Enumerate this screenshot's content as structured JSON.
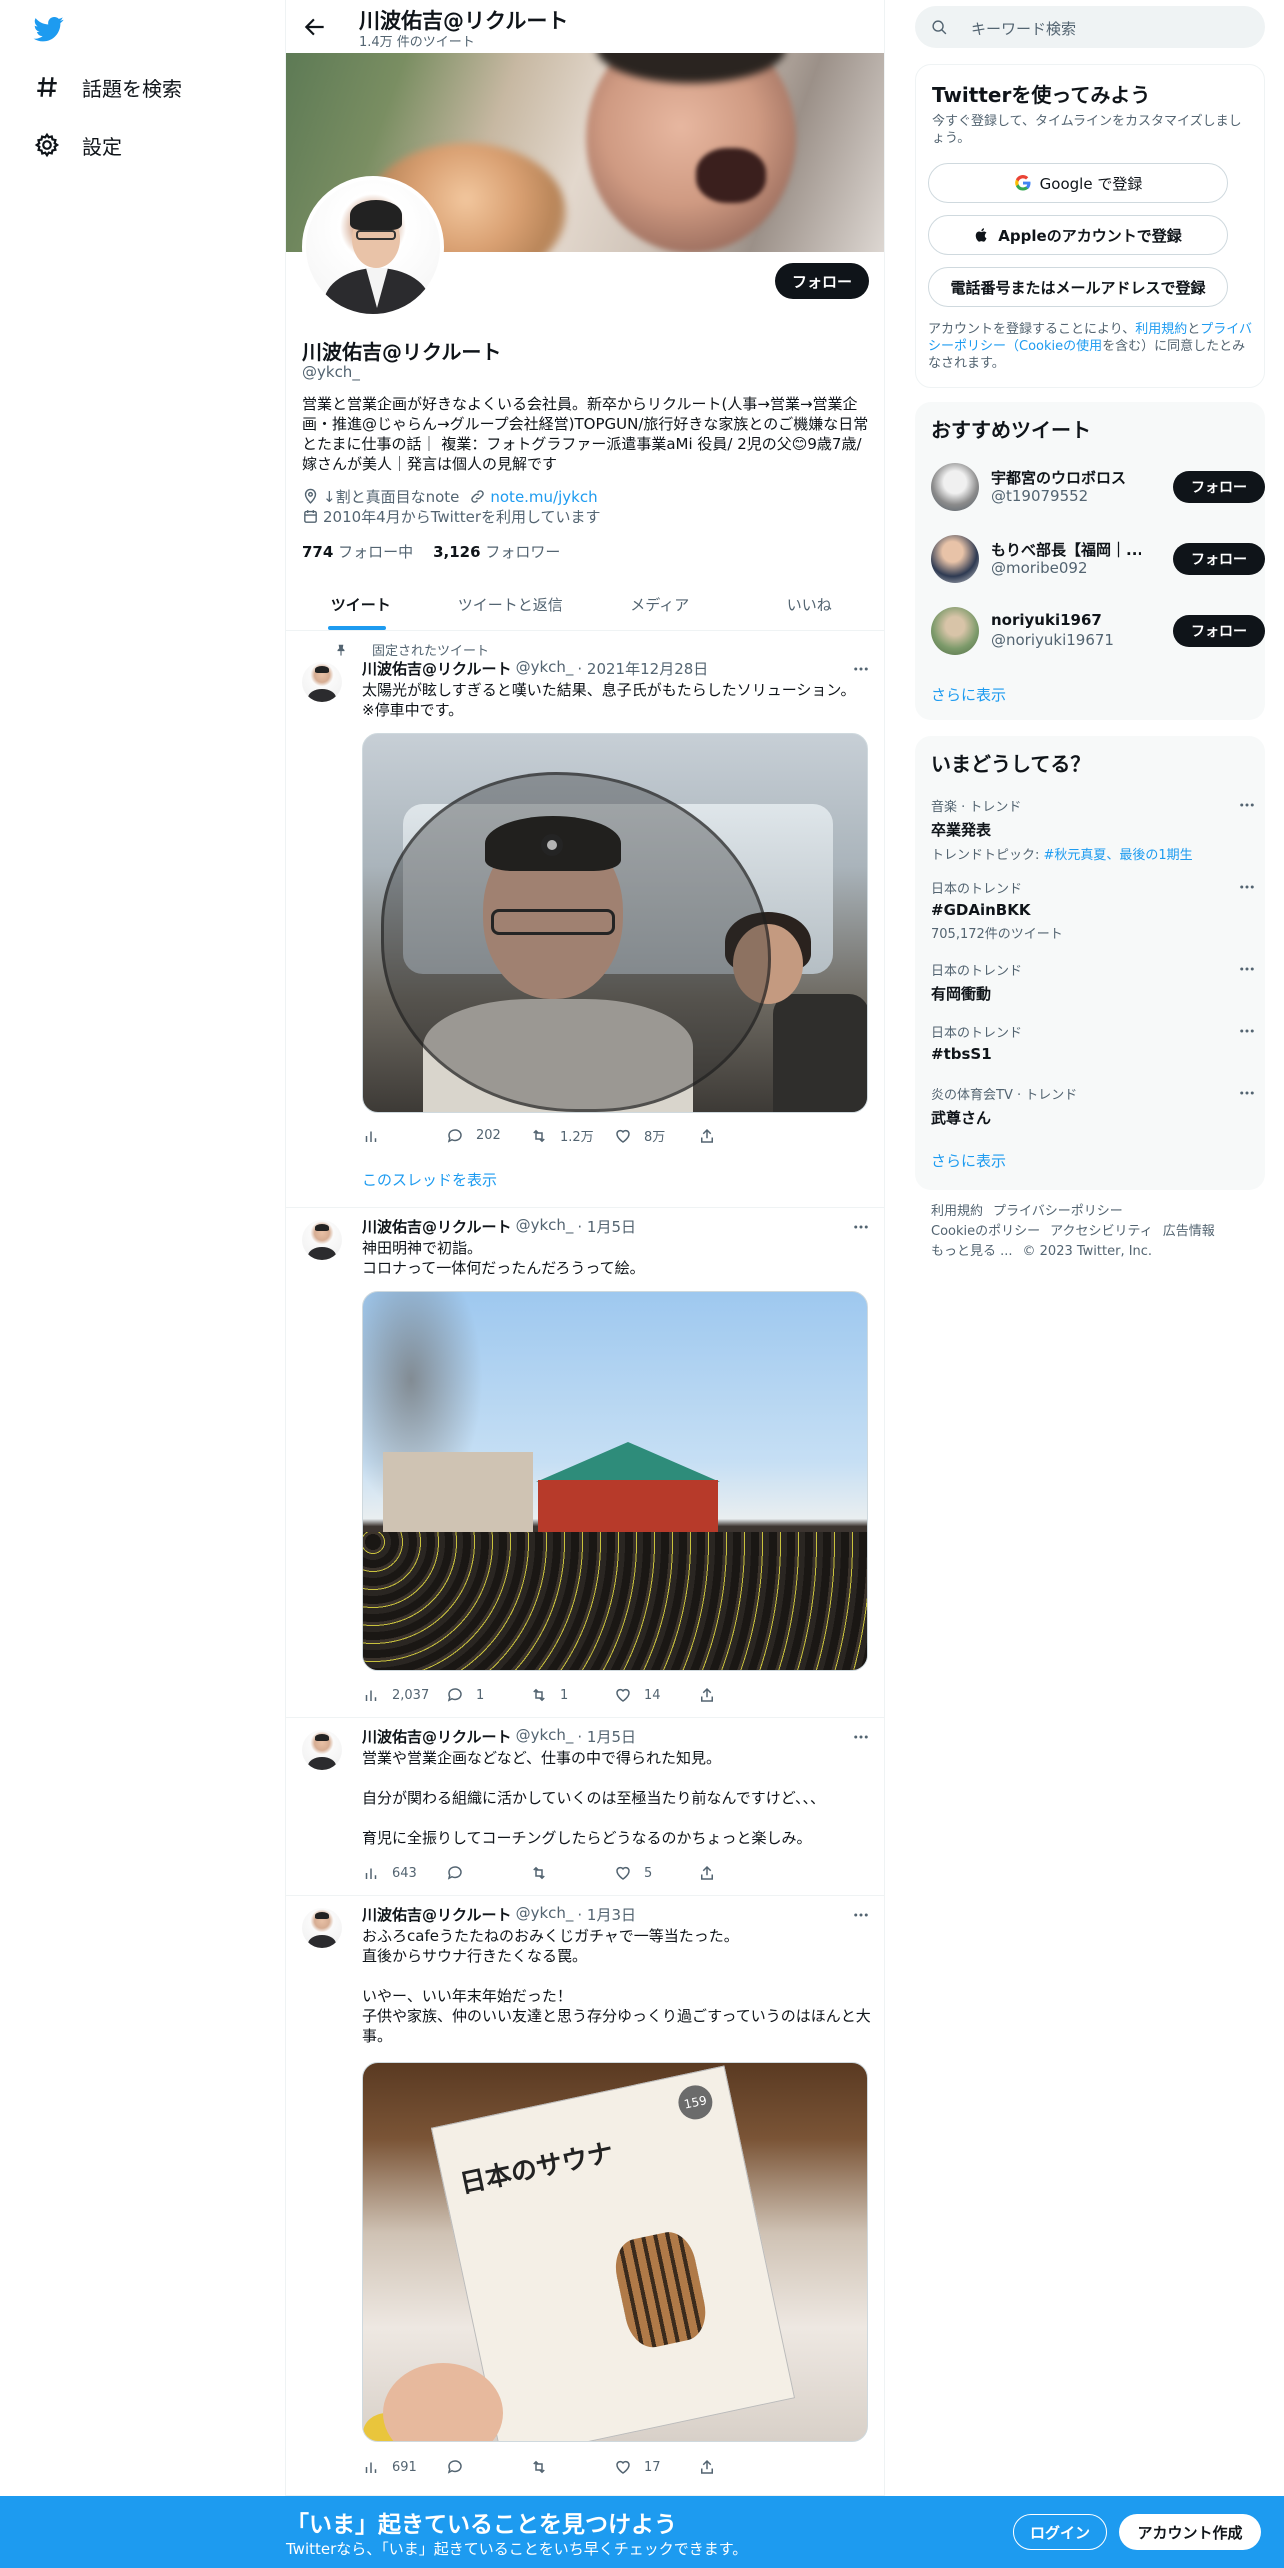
{
  "nav": {
    "explore": "話題を検索",
    "settings": "設定"
  },
  "header": {
    "name": "川波佑吉@リクルート",
    "tweet_count": "1.4万 件のツイート"
  },
  "profile": {
    "name": "川波佑吉@リクルート",
    "handle": "@ykch_",
    "follow": "フォロー",
    "bio": "営業と営業企画が好きなよくいる会社員。新卒からリクルート(人事→営業→営業企画・推進@じゃらん→グループ会社経営)TOPGUN/旅行好きな家族とのご機嫌な日常とたまに仕事の話｜ 複業：フォトグラファー派遣事業aMi 役員/ 2児の父😊9歳7歳/ 嫁さんが美人｜発言は個人の見解です",
    "note_text": "↓割と真面目なnote",
    "link": "note.mu/jykch",
    "joined": "2010年4月からTwitterを利用しています",
    "following_count": "774",
    "following_label": "フォロー中",
    "followers_count": "3,126",
    "followers_label": "フォロワー"
  },
  "tabs": [
    "ツイート",
    "ツイートと返信",
    "メディア",
    "いいね"
  ],
  "pinned_label": "固定されたツイート",
  "show_thread": "このスレッドを表示",
  "tweets": [
    {
      "name": "川波佑吉@リクルート",
      "handle": "@ykch_",
      "date": "· 2021年12月28日",
      "text": "太陽光が眩しすぎると嘆いた結果、息子氏がもたらしたソリューション。\n※停車中です。",
      "views": "",
      "replies": "202",
      "retweets": "1.2万",
      "likes": "8万"
    },
    {
      "name": "川波佑吉@リクルート",
      "handle": "@ykch_",
      "date": "· 1月5日",
      "text": "神田明神で初詣。\nコロナって一体何だったんだろうって絵。",
      "views": "2,037",
      "replies": "1",
      "retweets": "1",
      "likes": "14"
    },
    {
      "name": "川波佑吉@リクルート",
      "handle": "@ykch_",
      "date": "· 1月5日",
      "text": "営業や営業企画などなど、仕事の中で得られた知見。\n\n自分が関わる組織に活かしていくのは至極当たり前なんですけど、、、\n\n育児に全振りしてコーチングしたらどうなるのかちょっと楽しみ。",
      "views": "643",
      "replies": "",
      "retweets": "",
      "likes": "5"
    },
    {
      "name": "川波佑吉@リクルート",
      "handle": "@ykch_",
      "date": "· 1月3日",
      "text": "おふろcafeうたたねのおみくじガチャで一等当たった。\n直後からサウナ行きたくなる罠。\n\nいやー、いい年末年始だった！\n子供や家族、仲のいい友達と思う存分ゆっくり過ごすっていうのはほんと大事。",
      "views": "691",
      "replies": "",
      "retweets": "",
      "likes": "17"
    }
  ],
  "magazine": {
    "title": "日本のサウナ",
    "badge": "159"
  },
  "search": {
    "placeholder": "キーワード検索"
  },
  "signup": {
    "title": "Twitterを使ってみよう",
    "subtitle": "今すぐ登録して、タイムラインをカスタマイズしましょう。",
    "google": "Google で登録",
    "apple": "Appleのアカウントで登録",
    "phone": "電話番号またはメールアドレスで登録",
    "legal_prefix": "アカウントを登録することにより、",
    "legal_terms": "利用規約",
    "legal_and": "と",
    "legal_privacy": "プライバシーポリシー（Cookieの使用",
    "legal_suffix": "を含む）に同意したとみなされます。"
  },
  "recommended": {
    "title": "おすすめツイート",
    "users": [
      {
        "name": "宇都宮のウロボロス",
        "handle": "@t19079552",
        "follow": "フォロー"
      },
      {
        "name": "もりべ部長【福岡｜...",
        "handle": "@moribe092",
        "follow": "フォロー"
      },
      {
        "name": "noriyuki1967",
        "handle": "@noriyuki19671",
        "follow": "フォロー"
      }
    ],
    "more": "さらに表示"
  },
  "trends": {
    "title": "いまどうしてる？",
    "items": [
      {
        "meta": "音楽 · トレンド",
        "name": "卒業発表",
        "sub_prefix": "トレンドトピック: ",
        "sub_link": "#秋元真夏、最後の1期生"
      },
      {
        "meta": "日本のトレンド",
        "name": "#GDAinBKK",
        "sub": "705,172件のツイート"
      },
      {
        "meta": "日本のトレンド",
        "name": "有岡衝動",
        "sub": ""
      },
      {
        "meta": "日本のトレンド",
        "name": "#tbsS1",
        "sub": ""
      },
      {
        "meta": "炎の体育会TV · トレンド",
        "name": "武尊さん",
        "sub": ""
      }
    ],
    "more": "さらに表示"
  },
  "footer": {
    "terms": "利用規約",
    "privacy": "プライバシーポリシー",
    "cookie": "Cookieのポリシー",
    "accessibility": "アクセシビリティ",
    "ads": "広告情報",
    "more": "もっと見る ...",
    "copyright": "© 2023 Twitter, Inc."
  },
  "bottom": {
    "headline": "「いま」起きていることを見つけよう",
    "sub": "Twitterなら、「いま」起きていることをいち早くチェックできます。",
    "login": "ログイン",
    "signup": "アカウント作成"
  },
  "colors": {
    "accent": "#1d9bf0",
    "text": "#0f1419",
    "secondary": "#536471",
    "button": "#0f1419"
  }
}
